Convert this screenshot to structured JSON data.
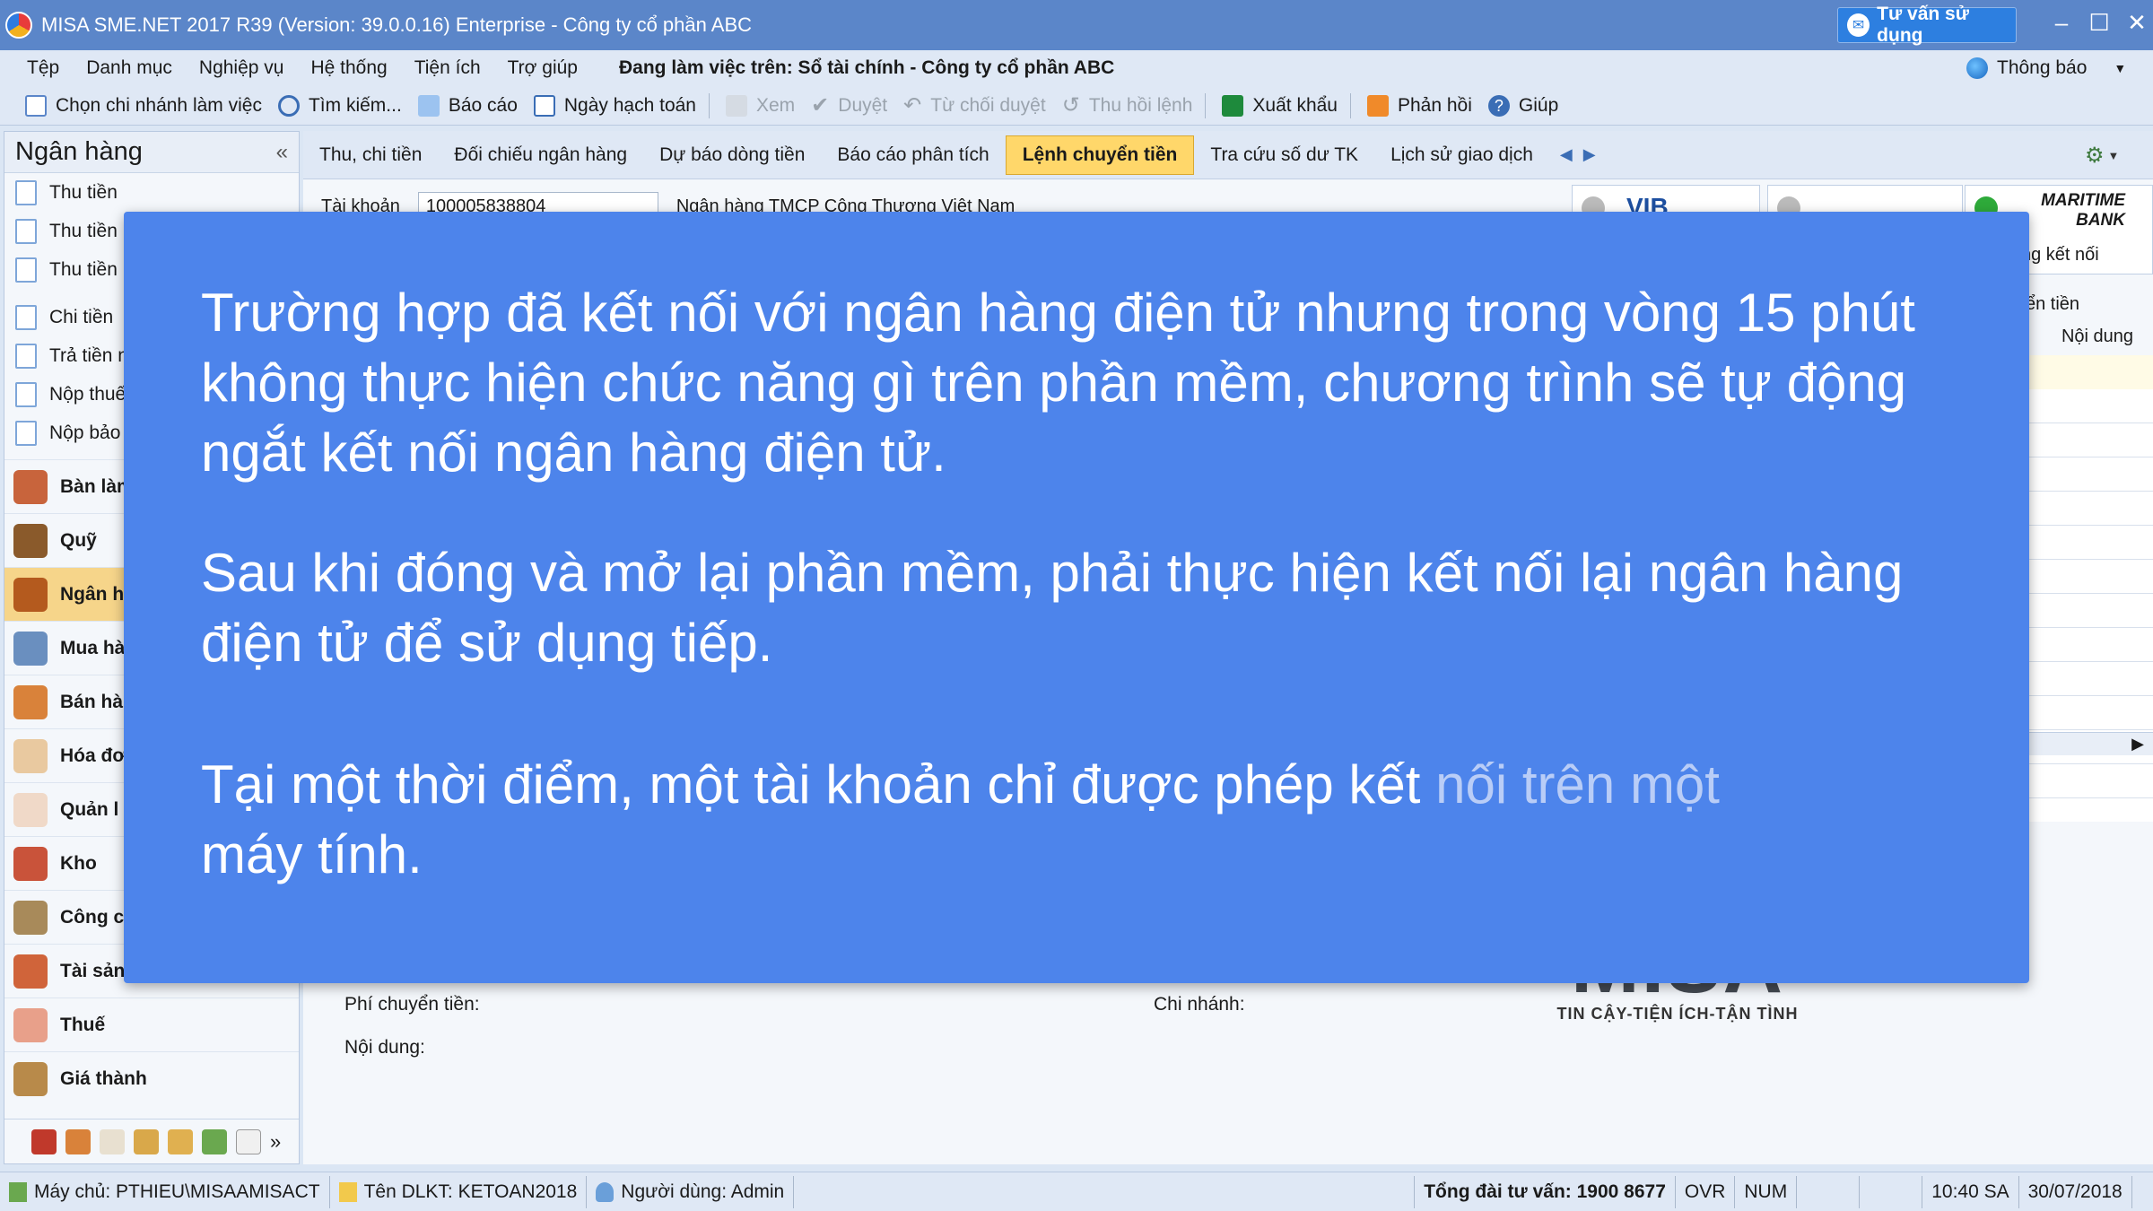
{
  "window": {
    "title": "MISA SME.NET 2017 R39 (Version: 39.0.0.16) Enterprise - Công ty cổ phần ABC",
    "consult_button": "Tư vấn sử dụng"
  },
  "menu": {
    "items": [
      "Tệp",
      "Danh mục",
      "Nghiệp vụ",
      "Hệ thống",
      "Tiện ích",
      "Trợ giúp"
    ],
    "working_on": "Đang làm việc trên: Sổ tài chính - Công ty cổ phần ABC",
    "notify": "Thông báo"
  },
  "toolbar": {
    "branch": "Chọn chi nhánh làm việc",
    "search": "Tìm kiếm...",
    "report": "Báo cáo",
    "posting_date": "Ngày hạch toán",
    "view": "Xem",
    "approve": "Duyệt",
    "reject": "Từ chối duyệt",
    "revoke": "Thu hồi lệnh",
    "export": "Xuất khẩu",
    "feedback": "Phản hồi",
    "help": "Giúp"
  },
  "sidebar": {
    "title": "Ngân hàng",
    "sub_items": [
      "Thu tiền",
      "Thu tiền",
      "Thu tiền",
      "Chi tiền",
      "Trả tiền n",
      "Nộp thuế",
      "Nộp bảo"
    ],
    "modules": [
      "Bàn làm",
      "Quỹ",
      "Ngân h",
      "Mua hà",
      "Bán hà",
      "Hóa đơ",
      "Quản l",
      "Kho",
      "Công c",
      "Tài sản cố định",
      "Thuế",
      "Giá thành"
    ]
  },
  "tabs": [
    "Thu, chi tiền",
    "Đối chiếu ngân hàng",
    "Dự báo dòng tiền",
    "Báo cáo phân tích",
    "Lệnh chuyển tiền",
    "Tra cứu số dư TK",
    "Lịch sử giao dịch"
  ],
  "content": {
    "account_label": "Tài khoản",
    "account_value": "100005838804",
    "bank_name": "Ngân hàng TMCP Công Thương Việt Nam",
    "bank_tile_1": "VIB",
    "maritime_line1": "MARITIME",
    "maritime_line2": "BANK",
    "connected": "ng kết nối",
    "grid_col_1": "ển tiền",
    "grid_col_2": "Nội dung",
    "fee_label": "Phí chuyển tiền:",
    "branch_label": "Chi nhánh:",
    "content_label": "Nội dung:"
  },
  "logo": {
    "word": "MISA",
    "tagline": "TIN CẬY-TIỆN ÍCH-TẬN TÌNH"
  },
  "statusbar": {
    "server": "Máy chủ: PTHIEU\\MISAAMISACT",
    "db": "Tên DLKT: KETOAN2018",
    "user": "Người dùng: Admin",
    "hotline": "Tổng đài tư vấn: 1900 8677",
    "ovr": "OVR",
    "num": "NUM",
    "time": "10:40 SA",
    "date": "30/07/2018"
  },
  "overlay": {
    "p1": "Trường hợp đã kết nối với ngân hàng điện tử nhưng trong vòng 15 phút không thực hiện chức năng gì trên phần mềm, chương trình sẽ tự động ngắt kết nối ngân hàng điện tử.",
    "p2": "Sau khi đóng và mở lại phần mềm, phải thực hiện kết nối lại ngân hàng điện tử để sử dụng tiếp.",
    "p3_main": "Tại một thời điểm, một tài khoản chỉ được phép kết ",
    "p3_fade": "nối trên một",
    "p3_end": "máy tính."
  },
  "colors": {
    "overlay_bg": "#4d84eb",
    "titlebar": "#5b86c9",
    "active_tab": "#ffd76a"
  }
}
